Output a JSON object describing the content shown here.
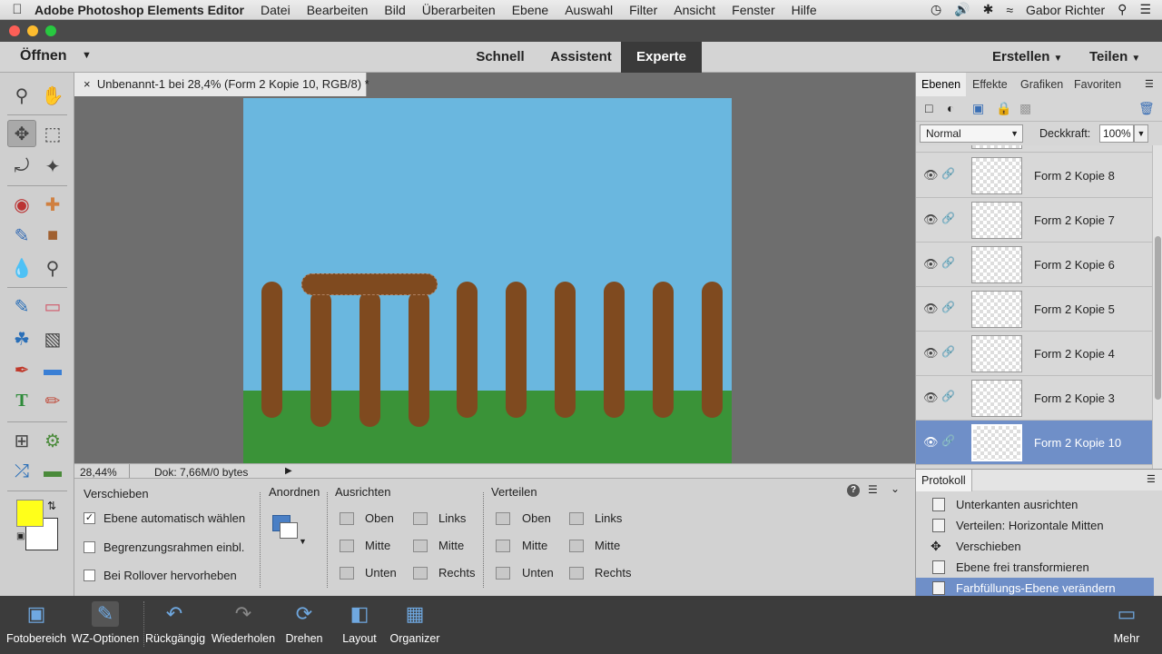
{
  "menubar": {
    "app_name": "Adobe Photoshop Elements Editor",
    "items": [
      "Datei",
      "Bearbeiten",
      "Bild",
      "Überarbeiten",
      "Ebene",
      "Auswahl",
      "Filter",
      "Ansicht",
      "Fenster",
      "Hilfe"
    ],
    "user": "Gabor Richter"
  },
  "modebar": {
    "open_label": "Öffnen",
    "modes": [
      "Schnell",
      "Assistent",
      "Experte"
    ],
    "active_mode": "Experte",
    "create_label": "Erstellen",
    "share_label": "Teilen"
  },
  "document": {
    "tab_title": "Unbenannt-1 bei 28,4% (Form 2 Kopie 10, RGB/8) *",
    "zoom": "28,44%",
    "doc_info": "Dok: 7,66M/0 bytes"
  },
  "options": {
    "tool_name": "Verschieben",
    "checkboxes": [
      {
        "label": "Ebene automatisch wählen",
        "checked": true
      },
      {
        "label": "Begrenzungsrahmen einbl.",
        "checked": false
      },
      {
        "label": "Bei Rollover hervorheben",
        "checked": false
      }
    ],
    "arrange_label": "Anordnen",
    "align_label": "Ausrichten",
    "align_items": [
      "Oben",
      "Links",
      "Mitte",
      "Mitte",
      "Unten",
      "Rechts"
    ],
    "distribute_label": "Verteilen",
    "distribute_items": [
      "Oben",
      "Links",
      "Mitte",
      "Mitte",
      "Unten",
      "Rechts"
    ]
  },
  "panel": {
    "tabs": [
      "Ebenen",
      "Effekte",
      "Grafiken",
      "Favoriten"
    ],
    "active_tab": "Ebenen",
    "blend_mode": "Normal",
    "opacity_label": "Deckkraft:",
    "opacity_value": "100%",
    "layers": [
      "Form 2 Kopie 8",
      "Form 2 Kopie 7",
      "Form 2 Kopie 6",
      "Form 2 Kopie 5",
      "Form 2 Kopie 4",
      "Form 2 Kopie 3",
      "Form 2 Kopie 10"
    ],
    "selected_layer": "Form 2 Kopie 10"
  },
  "history": {
    "title": "Protokoll",
    "items": [
      "Unterkanten ausrichten",
      "Verteilen: Horizontale Mitten",
      "Verschieben",
      "Ebene frei transformieren",
      "Farbfüllungs-Ebene verändern"
    ],
    "selected_item": "Farbfüllungs-Ebene verändern"
  },
  "bottombar": {
    "items": [
      "Fotobereich",
      "WZ-Optionen",
      "Rückgängig",
      "Wiederholen",
      "Drehen",
      "Layout",
      "Organizer"
    ],
    "more_label": "Mehr"
  },
  "colors": {
    "sky": "#6ab7df",
    "grass": "#3a9338",
    "wood": "#7f4a1f",
    "foreground": "#ffff1a",
    "background": "#ffffff",
    "selection": "#6f8fc8"
  }
}
